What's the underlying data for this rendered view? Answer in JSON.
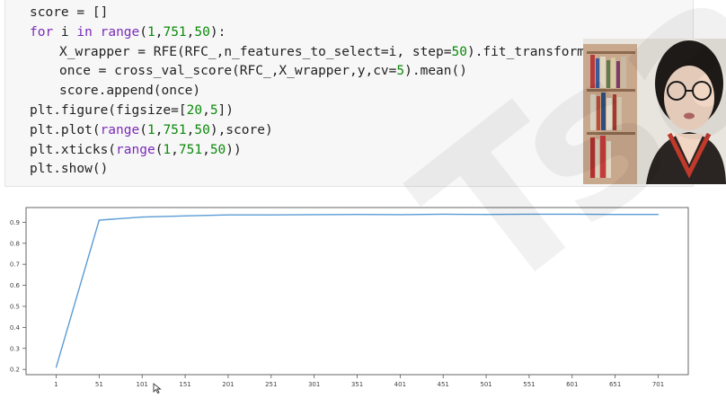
{
  "code_lines": [
    {
      "indent": 0,
      "parts": [
        {
          "t": "score = []"
        }
      ]
    },
    {
      "indent": 0,
      "parts": [
        {
          "t": "for",
          "c": "kw"
        },
        {
          "t": " i "
        },
        {
          "t": "in",
          "c": "kw"
        },
        {
          "t": " "
        },
        {
          "t": "range",
          "c": "kw"
        },
        {
          "t": "("
        },
        {
          "t": "1",
          "c": "num"
        },
        {
          "t": ","
        },
        {
          "t": "751",
          "c": "num"
        },
        {
          "t": ","
        },
        {
          "t": "50",
          "c": "num"
        },
        {
          "t": "):"
        }
      ]
    },
    {
      "indent": 1,
      "parts": [
        {
          "t": "X_wrapper = RFE(RFC_,n_features_to_select=i, step="
        },
        {
          "t": "50",
          "c": "num"
        },
        {
          "t": ").fit_transform(X,y)"
        }
      ]
    },
    {
      "indent": 1,
      "parts": [
        {
          "t": "once = cross_val_score(RFC_,X_wrapper,y,cv="
        },
        {
          "t": "5",
          "c": "num"
        },
        {
          "t": ").mean()"
        }
      ]
    },
    {
      "indent": 1,
      "parts": [
        {
          "t": "score.append(once)"
        }
      ]
    },
    {
      "indent": 0,
      "parts": [
        {
          "t": "plt.figure(figsize=["
        },
        {
          "t": "20",
          "c": "num"
        },
        {
          "t": ","
        },
        {
          "t": "5",
          "c": "num"
        },
        {
          "t": "])"
        }
      ]
    },
    {
      "indent": 0,
      "parts": [
        {
          "t": "plt.plot("
        },
        {
          "t": "range",
          "c": "kw"
        },
        {
          "t": "("
        },
        {
          "t": "1",
          "c": "num"
        },
        {
          "t": ","
        },
        {
          "t": "751",
          "c": "num"
        },
        {
          "t": ","
        },
        {
          "t": "50",
          "c": "num"
        },
        {
          "t": "),score)"
        }
      ]
    },
    {
      "indent": 0,
      "parts": [
        {
          "t": "plt.xticks("
        },
        {
          "t": "range",
          "c": "kw"
        },
        {
          "t": "("
        },
        {
          "t": "1",
          "c": "num"
        },
        {
          "t": ","
        },
        {
          "t": "751",
          "c": "num"
        },
        {
          "t": ","
        },
        {
          "t": "50",
          "c": "num"
        },
        {
          "t": "))"
        }
      ]
    },
    {
      "indent": 0,
      "parts": [
        {
          "t": "plt.show()"
        }
      ]
    }
  ],
  "colors": {
    "keyword": "#7a2ab8",
    "number": "#0b8a0b",
    "line": "#5b9bd5"
  },
  "watermark": "Tsal",
  "chart_data": {
    "type": "line",
    "x": [
      1,
      51,
      101,
      151,
      201,
      251,
      301,
      351,
      401,
      451,
      501,
      551,
      601,
      651,
      701
    ],
    "y": [
      0.21,
      0.91,
      0.925,
      0.93,
      0.935,
      0.935,
      0.936,
      0.937,
      0.936,
      0.938,
      0.937,
      0.938,
      0.938,
      0.937,
      0.937
    ],
    "xticks": [
      "1",
      "51",
      "101",
      "151",
      "201",
      "251",
      "301",
      "351",
      "401",
      "451",
      "501",
      "551",
      "601",
      "651",
      "701"
    ],
    "yticks": [
      "0.2",
      "0.3",
      "0.4",
      "0.5",
      "0.6",
      "0.7",
      "0.8",
      "0.9"
    ],
    "xlim": [
      -34,
      736
    ],
    "ylim": [
      0.175,
      0.97
    ],
    "grid": false,
    "title": "",
    "xlabel": "",
    "ylabel": ""
  }
}
